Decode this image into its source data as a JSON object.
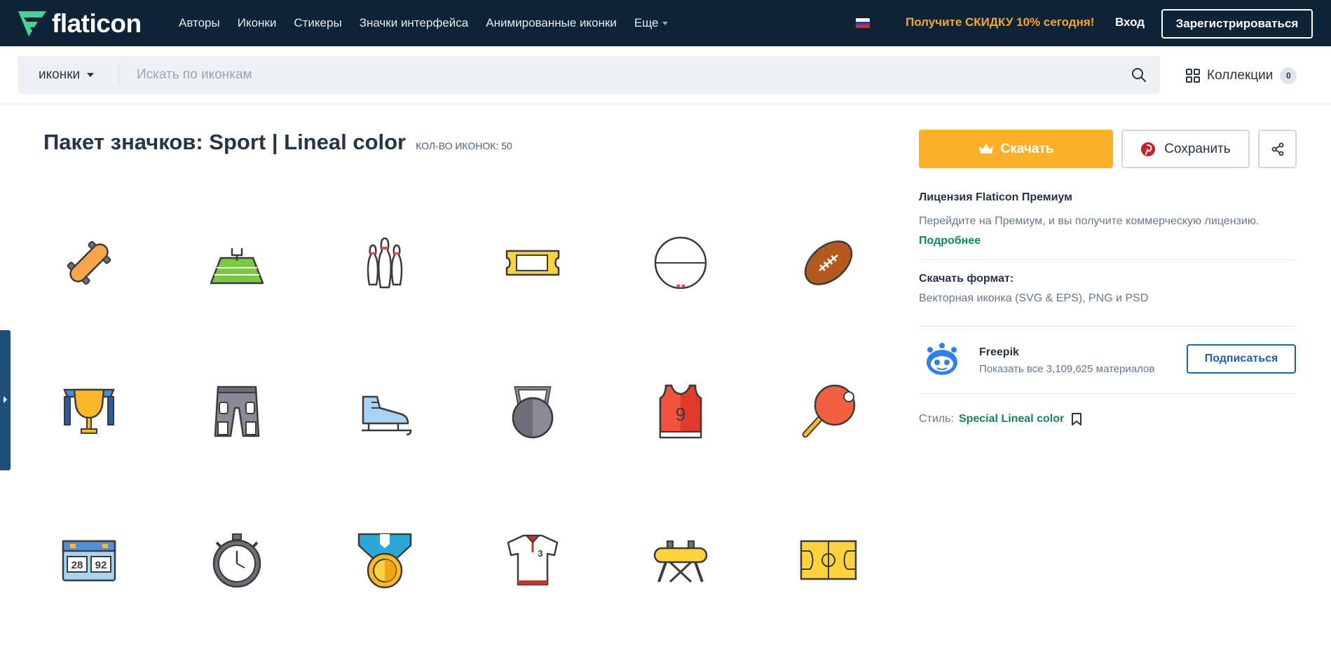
{
  "brand": {
    "name": "flaticon",
    "accent": "#4ad295"
  },
  "nav": {
    "items": [
      "Авторы",
      "Иконки",
      "Стикеры",
      "Значки интерфейса",
      "Анимированные иконки"
    ],
    "more_label": "Еще",
    "promo": "Получите СКИДКУ 10% сегодня!",
    "login": "Вход",
    "register": "Зарегистрироваться"
  },
  "search": {
    "type_label": "иконки",
    "placeholder": "Искать по иконкам",
    "collections_label": "Коллекции",
    "collections_count": "0"
  },
  "pack": {
    "title": "Пакет значков: Sport | Lineal color",
    "count_label": "КОЛ-ВО ИКОНОК: 50",
    "icons": [
      "skateboard-icon",
      "football-field-icon",
      "bowling-pins-icon",
      "ticket-icon",
      "ball-icon",
      "rugby-ball-icon",
      "trophy-icon",
      "football-pants-icon",
      "ice-skate-icon",
      "kettlebell-icon",
      "basketball-jersey-icon",
      "ping-pong-paddle-icon",
      "scoreboard-icon",
      "stopwatch-icon",
      "medal-icon",
      "sport-shirt-icon",
      "pommel-horse-icon",
      "basketball-court-icon"
    ],
    "scoreboard": [
      "28",
      "92"
    ],
    "jersey_number": "9",
    "shirt_number": "3"
  },
  "panel": {
    "download": "Скачать",
    "save": "Сохранить",
    "license_title": "Лицензия Flaticon Премиум",
    "license_desc": "Перейдите на Премиум, и вы получите коммерческую лицензию.",
    "license_more": "Подробнее",
    "format_title": "Скачать формат:",
    "format_desc": "Векторная иконка (SVG & EPS), PNG и PSD",
    "author_name": "Freepik",
    "author_sub": "Показать все 3,109,625 материалов",
    "follow": "Подписаться",
    "style_label": "Стиль:",
    "style_value": "Special Lineal color"
  },
  "colors": {
    "nav_bg": "#0d2436",
    "promo": "#f9a72b",
    "download": "#fbb029",
    "link": "#0f8563",
    "follow": "#1f5fa8"
  }
}
